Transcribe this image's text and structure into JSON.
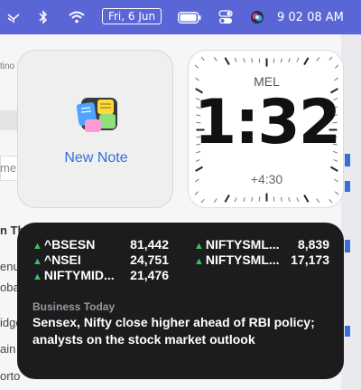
{
  "menubar": {
    "date": "Fri, 6 Jun",
    "time": "9 02 08 AM",
    "icons": [
      "dashes-icon",
      "bluetooth-icon",
      "wifi-icon",
      "battery-icon",
      "control-center-icon",
      "siri-icon"
    ]
  },
  "background_app": {
    "fragments": [
      "tino",
      "me",
      "n Th",
      "enu",
      "oba",
      "idge",
      "ain",
      "orto"
    ]
  },
  "note_widget": {
    "label": "New Note"
  },
  "clock_widget": {
    "city": "MEL",
    "time": "1:32",
    "offset": "+4:30"
  },
  "stocks_widget": {
    "stocks": [
      {
        "symbol": "^BSESN",
        "value": "81,442"
      },
      {
        "symbol": "^NSEI",
        "value": "24,751"
      },
      {
        "symbol": "NIFTYMID...",
        "value": "21,476"
      },
      {
        "symbol": "NIFTYSML...",
        "value": "8,839"
      },
      {
        "symbol": "NIFTYSML...",
        "value": "17,173"
      }
    ],
    "news_source": "Business Today",
    "news_headline": "Sensex, Nifty close higher ahead of RBI policy; analysts on the stock market outlook"
  },
  "colors": {
    "menubar": "#5b66d6",
    "up": "#34c759",
    "link": "#2f6fd8"
  }
}
